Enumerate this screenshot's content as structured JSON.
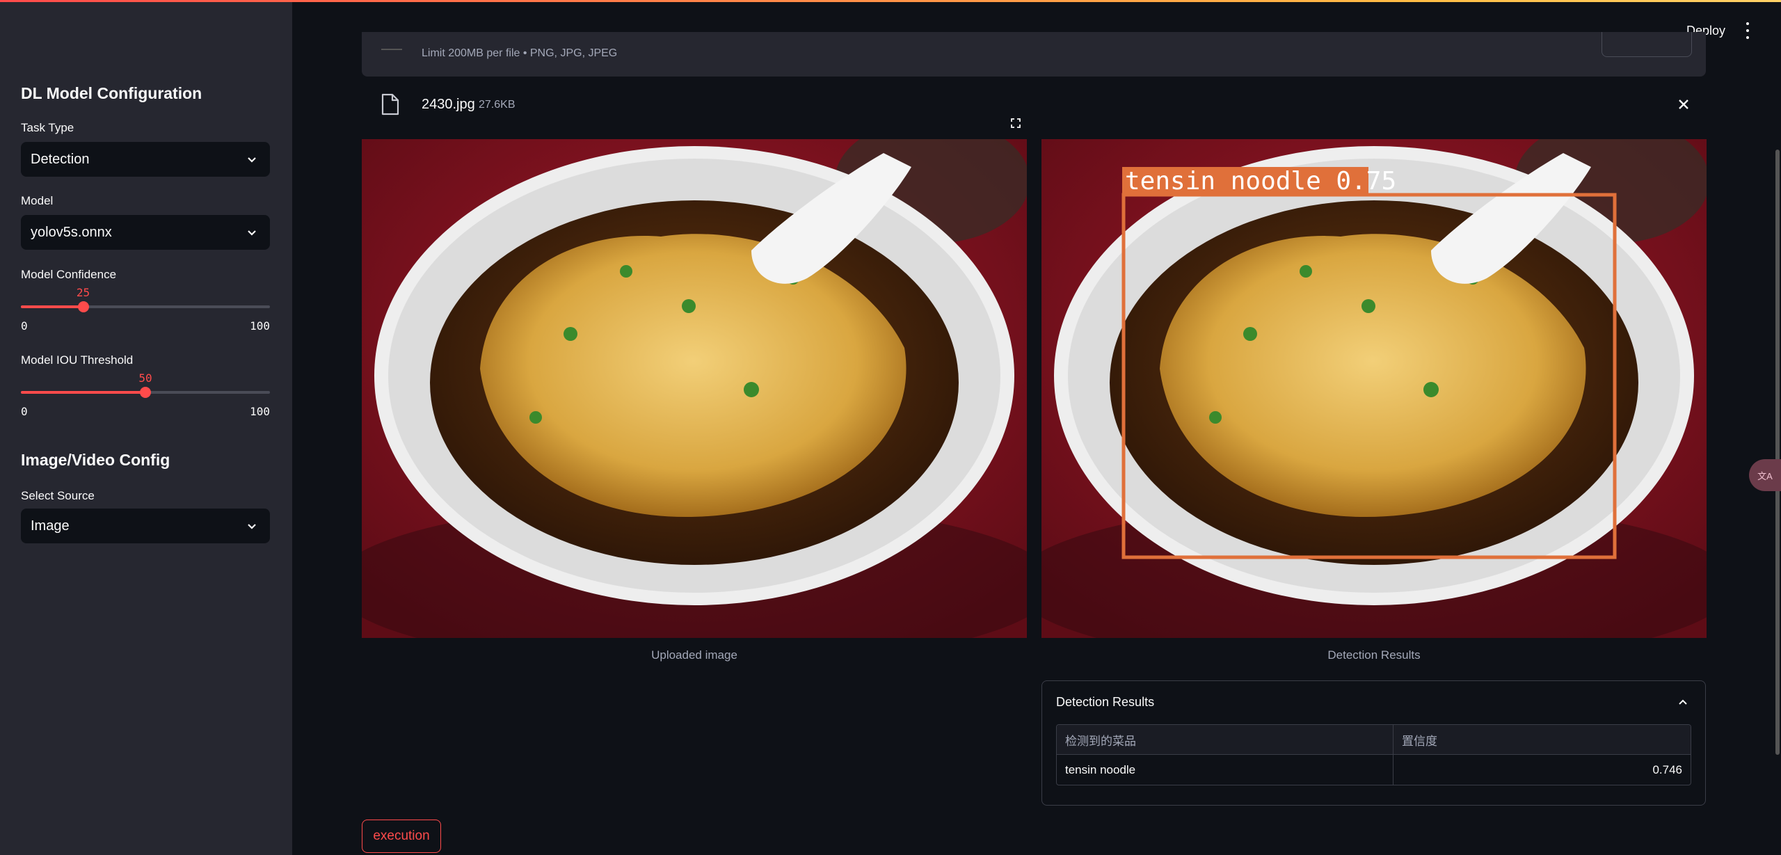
{
  "sidebar": {
    "model_section_title": "DL Model Configuration",
    "task_type_label": "Task Type",
    "task_type_value": "Detection",
    "model_label": "Model",
    "model_value": "yolov5s.onnx",
    "confidence": {
      "label": "Model Confidence",
      "value": "25",
      "min": "0",
      "max": "100",
      "fraction": 0.25
    },
    "iou": {
      "label": "Model IOU Threshold",
      "value": "50",
      "min": "0",
      "max": "100",
      "fraction": 0.5
    },
    "source_section_title": "Image/Video Config",
    "source_label": "Select Source",
    "source_value": "Image"
  },
  "header": {
    "deploy_label": "Deploy"
  },
  "uploader": {
    "hint": "Limit 200MB per file • PNG, JPG, JPEG",
    "file_name": "2430.jpg",
    "file_size": "27.6KB"
  },
  "images": {
    "uploaded_caption": "Uploaded image",
    "result_caption": "Detection Results",
    "detection_label": "tensin noodle 0.75"
  },
  "results": {
    "title": "Detection Results",
    "columns": [
      "检测到的菜品",
      "置信度"
    ],
    "rows": [
      [
        "tensin noodle",
        "0.746"
      ]
    ]
  },
  "execute_label": "execution",
  "side_badge": "文A",
  "colors": {
    "accent": "#ff4b4b",
    "bbox": "#e0703a",
    "sidebar": "#262730",
    "background": "#0e1117"
  },
  "icons": [
    "chevron-down-icon",
    "file-icon",
    "close-icon",
    "expand-icon",
    "chevron-up-icon",
    "kebab-menu-icon"
  ]
}
